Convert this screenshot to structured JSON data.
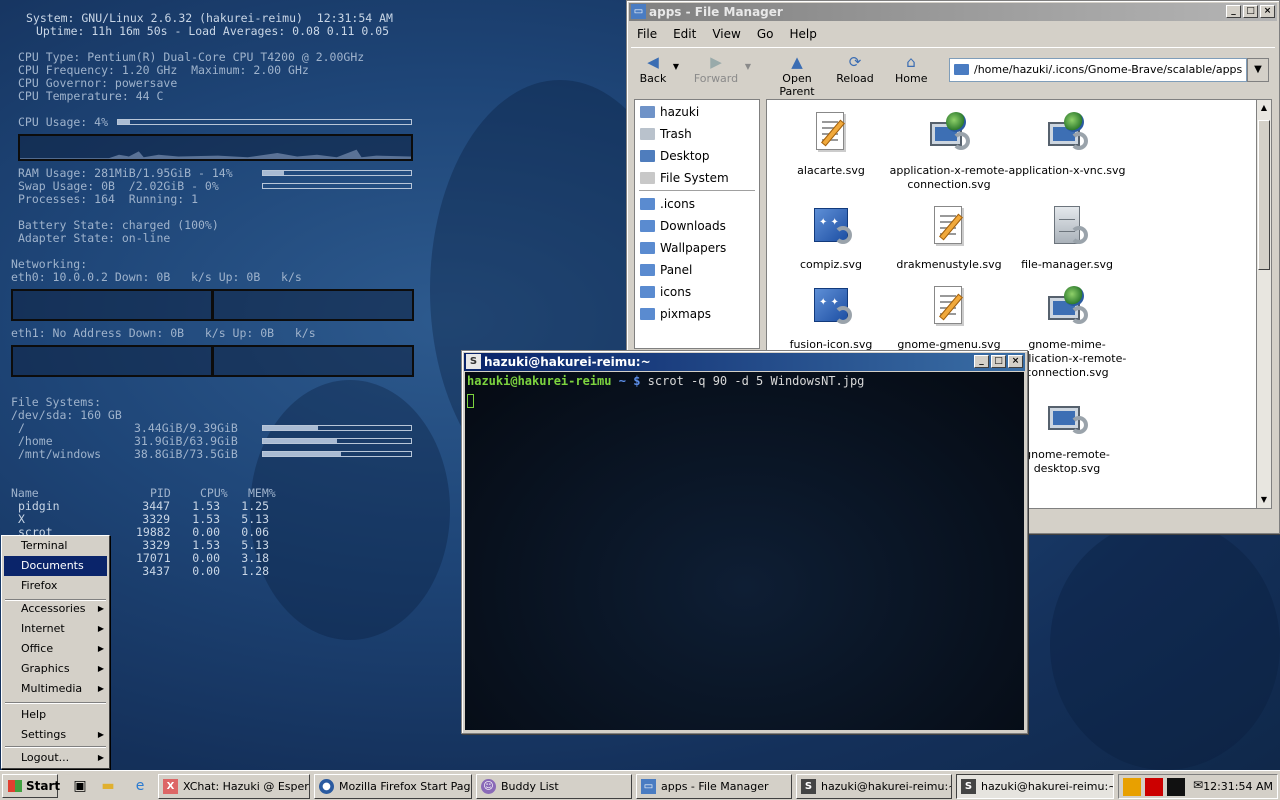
{
  "conky": {
    "system_line": "System: GNU/Linux 2.6.32 (hakurei-reimu)  12:31:54 AM",
    "uptime_line": "Uptime: 11h 16m 50s - Load Averages: 0.08 0.11 0.05",
    "cpu_type": "CPU Type: Pentium(R) Dual-Core CPU T4200 @ 2.00GHz",
    "cpu_freq": "CPU Frequency: 1.20 GHz  Maximum: 2.00 GHz",
    "cpu_gov": "CPU Governor: powersave",
    "cpu_temp": "CPU Temperature: 44 C",
    "cpu_usage": "CPU Usage: 4%",
    "cpu_usage_pct": 4,
    "ram_usage": "RAM Usage: 281MiB/1.95GiB - 14%",
    "ram_pct": 14,
    "swap_usage": "Swap Usage: 0B  /2.02GiB - 0%",
    "swap_pct": 0,
    "processes": "Processes: 164  Running: 1",
    "battery": "Battery State: charged (100%)",
    "adapter": "Adapter State: on-line",
    "networking": "Networking:",
    "eth0": "eth0: 10.0.0.2 Down: 0B   k/s Up: 0B   k/s",
    "eth1": "eth1: No Address Down: 0B   k/s Up: 0B   k/s",
    "fs_title": "File Systems:",
    "fs_dev": "/dev/sda: 160 GB",
    "filesystems": [
      {
        "mount": "/",
        "usage": "3.44GiB/9.39GiB",
        "pct": 37
      },
      {
        "mount": "/home",
        "usage": "31.9GiB/63.9GiB",
        "pct": 50
      },
      {
        "mount": "/mnt/windows",
        "usage": "38.8GiB/73.5GiB",
        "pct": 53
      }
    ],
    "proc_header": {
      "name": "Name",
      "pid": "PID",
      "cpu": "CPU%",
      "mem": "MEM%"
    },
    "procs": [
      {
        "name": "pidgin",
        "pid": "3447",
        "cpu": "1.53",
        "mem": "1.25"
      },
      {
        "name": "X",
        "pid": "3329",
        "cpu": "1.53",
        "mem": "5.13"
      },
      {
        "name": "scrot",
        "pid": "19882",
        "cpu": "0.00",
        "mem": "0.06"
      },
      {
        "name": "",
        "pid": "3329",
        "cpu": "1.53",
        "mem": "5.13"
      },
      {
        "name": "",
        "pid": "17071",
        "cpu": "0.00",
        "mem": "3.18"
      },
      {
        "name": "",
        "pid": "3437",
        "cpu": "0.00",
        "mem": "1.28"
      }
    ]
  },
  "file_manager": {
    "title": "apps - File Manager",
    "menu": [
      "File",
      "Edit",
      "View",
      "Go",
      "Help"
    ],
    "toolbar": {
      "back": "Back",
      "forward": "Forward",
      "open_parent": "Open Parent",
      "reload": "Reload",
      "home": "Home"
    },
    "address": "/home/hazuki/.icons/Gnome-Brave/scalable/apps",
    "sidebar": [
      "hazuki",
      "Trash",
      "Desktop",
      "File System",
      ".icons",
      "Downloads",
      "Wallpapers",
      "Panel",
      "icons",
      "pixmaps"
    ],
    "files": [
      {
        "name": "alacarte.svg",
        "icon": "document-pencil-icon"
      },
      {
        "name": "application-x-remote-connection.svg",
        "icon": "monitor-globe-icon"
      },
      {
        "name": "application-x-vnc.svg",
        "icon": "monitor-globe-icon"
      },
      {
        "name": "compiz.svg",
        "icon": "blue-square-icon"
      },
      {
        "name": "drakmenustyle.svg",
        "icon": "document-pencil-icon"
      },
      {
        "name": "file-manager.svg",
        "icon": "cabinet-icon"
      },
      {
        "name": "fusion-icon.svg",
        "icon": "blue-square-icon"
      },
      {
        "name": "gnome-gmenu.svg",
        "icon": "document-pencil-icon"
      },
      {
        "name": "gnome-mime-application-x-remote-connection.svg",
        "icon": "monitor-globe-icon"
      },
      {
        "name": "gnome-remote-desktop.svg",
        "icon": "monitor-icon"
      }
    ]
  },
  "terminal": {
    "title": "hazuki@hakurei-reimu:~",
    "prompt_user": "hazuki@hakurei-reimu",
    "prompt_dir": "~",
    "prompt_sym": "$",
    "command": "scrot -q 90 -d 5 WindowsNT.jpg"
  },
  "start_menu": {
    "items": [
      {
        "label": "Terminal",
        "submenu": false
      },
      {
        "label": "Documents",
        "submenu": false,
        "selected": true
      },
      {
        "label": "Firefox",
        "submenu": false
      },
      {
        "label": "Accessories",
        "submenu": true
      },
      {
        "label": "Internet",
        "submenu": true
      },
      {
        "label": "Office",
        "submenu": true
      },
      {
        "label": "Graphics",
        "submenu": true
      },
      {
        "label": "Multimedia",
        "submenu": true
      },
      {
        "label": "Help",
        "submenu": false
      },
      {
        "label": "Settings",
        "submenu": true
      },
      {
        "label": "Logout...",
        "submenu": true
      }
    ]
  },
  "taskbar": {
    "start_label": "Start",
    "tasks": [
      {
        "label": "XChat: Hazuki @ Esper",
        "icon": "xchat-icon"
      },
      {
        "label": "Mozilla Firefox Start Page...",
        "icon": "firefox-icon"
      },
      {
        "label": "Buddy List",
        "icon": "pidgin-icon"
      },
      {
        "label": "apps - File Manager",
        "icon": "folder-icon"
      },
      {
        "label": "hazuki@hakurei-reimu:~/...",
        "icon": "terminal-icon"
      },
      {
        "label": "hazuki@hakurei-reimu:~",
        "icon": "terminal-icon",
        "active": true
      }
    ],
    "clock": "12:31:54 AM"
  }
}
